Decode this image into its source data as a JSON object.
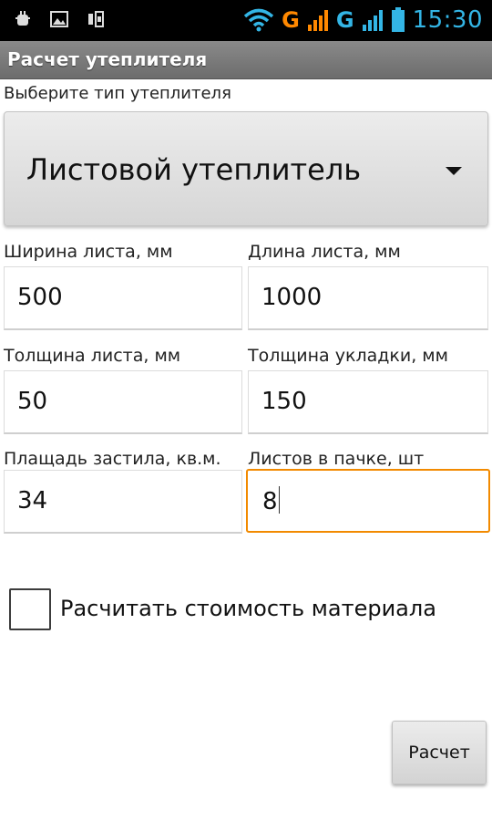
{
  "status_bar": {
    "time": "15:30",
    "network_1": "G",
    "network_2": "G",
    "icons": [
      "usb-debug-icon",
      "gallery-icon",
      "sim-icon",
      "wifi-icon",
      "signal-icon",
      "battery-icon"
    ]
  },
  "app": {
    "title": "Расчет утеплителя"
  },
  "form": {
    "type_label": "Выберите тип утеплителя",
    "type_value": "Листовой утеплитель",
    "width_label": "Ширина листа, мм",
    "width_value": "500",
    "length_label": "Длина листа, мм",
    "length_value": "1000",
    "thickness_label": "Толщина листа, мм",
    "thickness_value": "50",
    "layer_label": "Толщина укладки, мм",
    "layer_value": "150",
    "area_label": "Плащадь застила, кв.м.",
    "area_value": "34",
    "pack_label": "Листов в пачке, шт",
    "pack_value": "8",
    "cost_checkbox_label": "Расчитать стоимость материала",
    "cost_checked": false,
    "calc_button": "Расчет"
  },
  "colors": {
    "accent_blue": "#33b5e5",
    "accent_orange": "#ff8800",
    "focus_border": "#f28a00"
  }
}
